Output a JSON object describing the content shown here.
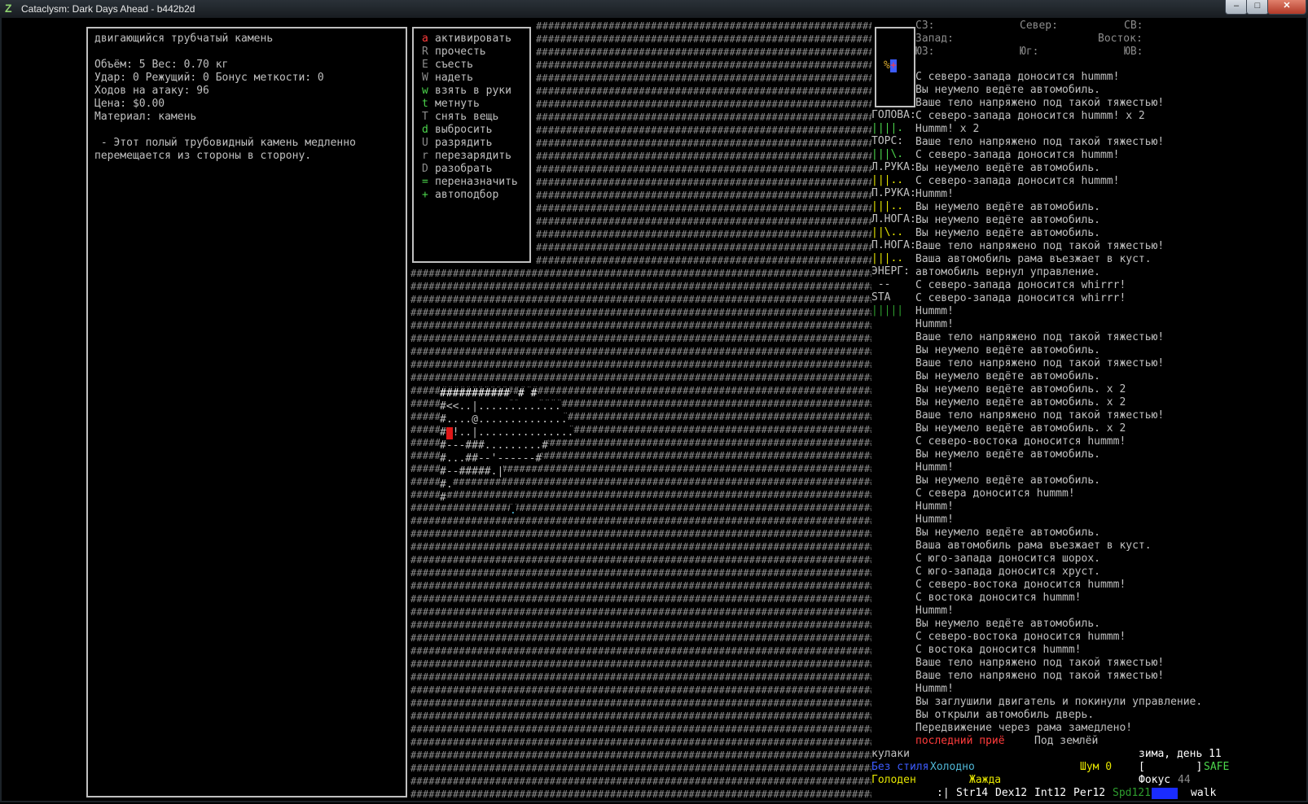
{
  "window": {
    "title": "Cataclysm: Dark Days Ahead - b442b2d",
    "icon": "Z",
    "btn_min": "–",
    "btn_max": "□",
    "btn_close": "✕"
  },
  "item": {
    "name": "двигающийся трубчатый камень",
    "stats": [
      "Объём: 5 Вес: 0.70 кг",
      "Удар: 0 Режущий: 0 Бонус меткости: 0",
      "Ходов на атаку: 96",
      "Цена: $0.00",
      "Материал: камень"
    ],
    "description": [
      " - Этот полый трубовидный камень медленно",
      "перемещается из стороны в сторону."
    ]
  },
  "actions": [
    {
      "key": "a",
      "label": "активировать",
      "color": "#ff3b3b"
    },
    {
      "key": "R",
      "label": "прочесть",
      "color": "#8c8c8c"
    },
    {
      "key": "E",
      "label": "съесть",
      "color": "#8c8c8c"
    },
    {
      "key": "W",
      "label": "надеть",
      "color": "#8c8c8c"
    },
    {
      "key": "w",
      "label": "взять в руки",
      "color": "#4cd64c"
    },
    {
      "key": "t",
      "label": "метнуть",
      "color": "#4cd64c"
    },
    {
      "key": "T",
      "label": "снять вещь",
      "color": "#8c8c8c"
    },
    {
      "key": "d",
      "label": "выбросить",
      "color": "#4cd64c"
    },
    {
      "key": "U",
      "label": "разрядить",
      "color": "#8c8c8c"
    },
    {
      "key": "r",
      "label": "перезарядить",
      "color": "#8c8c8c"
    },
    {
      "key": "D",
      "label": "разобрать",
      "color": "#8c8c8c"
    },
    {
      "key": "=",
      "label": "переназначить",
      "color": "#4cd64c"
    },
    {
      "key": "+",
      "label": "автоподбор",
      "color": "#4cd64c"
    }
  ],
  "minimap": {
    "glyph1": "%",
    "glyph2": "+"
  },
  "compass": {
    "nw": "СЗ:",
    "n": "Север:",
    "ne": "СВ:",
    "w": "Запад:",
    "e": "Восток:",
    "sw": "ЮЗ:",
    "s": "Юг:",
    "se": "ЮВ:"
  },
  "body": [
    {
      "part": "ГОЛОВА:",
      "bar": "||||.",
      "color": "#4cd64c"
    },
    {
      "part": "ТОРС:",
      "bar": "|||\\.",
      "color": "#4cd64c"
    },
    {
      "part": "Л.РУКА:",
      "bar": "|||..",
      "color": "#e6e600"
    },
    {
      "part": "П.РУКА:",
      "bar": "|||..",
      "color": "#e6e600"
    },
    {
      "part": "Л.НОГА:",
      "bar": "||\\..",
      "color": "#e6e600"
    },
    {
      "part": "П.НОГА:",
      "bar": "|||..",
      "color": "#e6e600"
    },
    {
      "part": "ЭНЕРГ:",
      "bar": " --",
      "color": "#c0c0c0"
    },
    {
      "part": "STA",
      "bar": "|||||",
      "color": "#2e9e2e"
    }
  ],
  "messages": [
    "С северо-запада доносится hummm!",
    "Вы неумело ведёте автомобиль.",
    "Ваше тело напряжено под такой тяжестью!",
    "С северо-запада доносится hummm! x 2",
    "Hummm! x 2",
    "Ваше тело напряжено под такой тяжестью!",
    "С северо-запада доносится hummm!",
    "Вы неумело ведёте автомобиль.",
    "С северо-запада доносится hummm!",
    "Hummm!",
    "Вы неумело ведёте автомобиль.",
    "Вы неумело ведёте автомобиль.",
    "Вы неумело ведёте автомобиль.",
    "Ваше тело напряжено под такой тяжестью!",
    "Ваша автомобиль рама въезжает в куст.",
    "автомобиль вернул управление.",
    "С северо-запада доносится whirrr!",
    "С северо-запада доносится whirrr!",
    "Hummm!",
    "Hummm!",
    "Ваше тело напряжено под такой тяжестью!",
    "Вы неумело ведёте автомобиль.",
    "Ваше тело напряжено под такой тяжестью!",
    "Вы неумело ведёте автомобиль.",
    "Вы неумело ведёте автомобиль. x 2",
    "Вы неумело ведёте автомобиль. x 2",
    "Ваше тело напряжено под такой тяжестью!",
    "Вы неумело ведёте автомобиль. x 2",
    "С северо-востока доносится hummm!",
    "Вы неумело ведёте автомобиль.",
    "Hummm!",
    "Вы неумело ведёте автомобиль.",
    "С севера доносится hummm!",
    "Hummm!",
    "Hummm!",
    "Вы неумело ведёте автомобиль.",
    "Ваша автомобиль рама въезжает в куст.",
    "С юго-запада доносится шорох.",
    "С юго-запада доносится хруст.",
    "С северо-востока доносится hummm!",
    "С востока доносится hummm!",
    "Hummm!",
    "Вы неумело ведёте автомобиль.",
    "С северо-востока доносится hummm!",
    "С востока доносится hummm!",
    "Ваше тело напряжено под такой тяжестью!",
    "Ваше тело напряжено под такой тяжестью!",
    "Hummm!",
    "Вы заглушили двигатель и покинули управление.",
    "Вы открыли автомобиль дверь.",
    "Передвижение через рама замедлено!"
  ],
  "status": {
    "last_message": "последний приё",
    "location": "Под землёй",
    "weapon": "кулаки",
    "style": "Без стиля",
    "temp": "Холодно",
    "hunger": "Голоден",
    "thirst": "Жажда",
    "noise": "Шум 0",
    "date": "зима, день 11",
    "bracket": "[        ]",
    "safe": "SAFE",
    "focus_label": "Фокус",
    "focus_val": "44",
    "face": ":|",
    "str": "Str14",
    "dex": "Dex12",
    "int": "Int12",
    "per": "Per12",
    "spd": "Spd121",
    "move": "walk"
  },
  "map": {
    "rows": [
      "###########",
      "#<<..|.............",
      "#....@..............",
      "#.!..|...............",
      "#---###.........#",
      "#...##--'------#",
      "#--#####.|",
      "#.",
      "#",
      ""
    ],
    "extra_tail": "# #",
    "cursor": "."
  },
  "colors": {
    "green": "#4cd64c",
    "yellow": "#e6e600",
    "red": "#ff3b3b",
    "blue": "#3d5cff",
    "cyan": "#4fb6d6",
    "grey": "#8a8a8a"
  }
}
